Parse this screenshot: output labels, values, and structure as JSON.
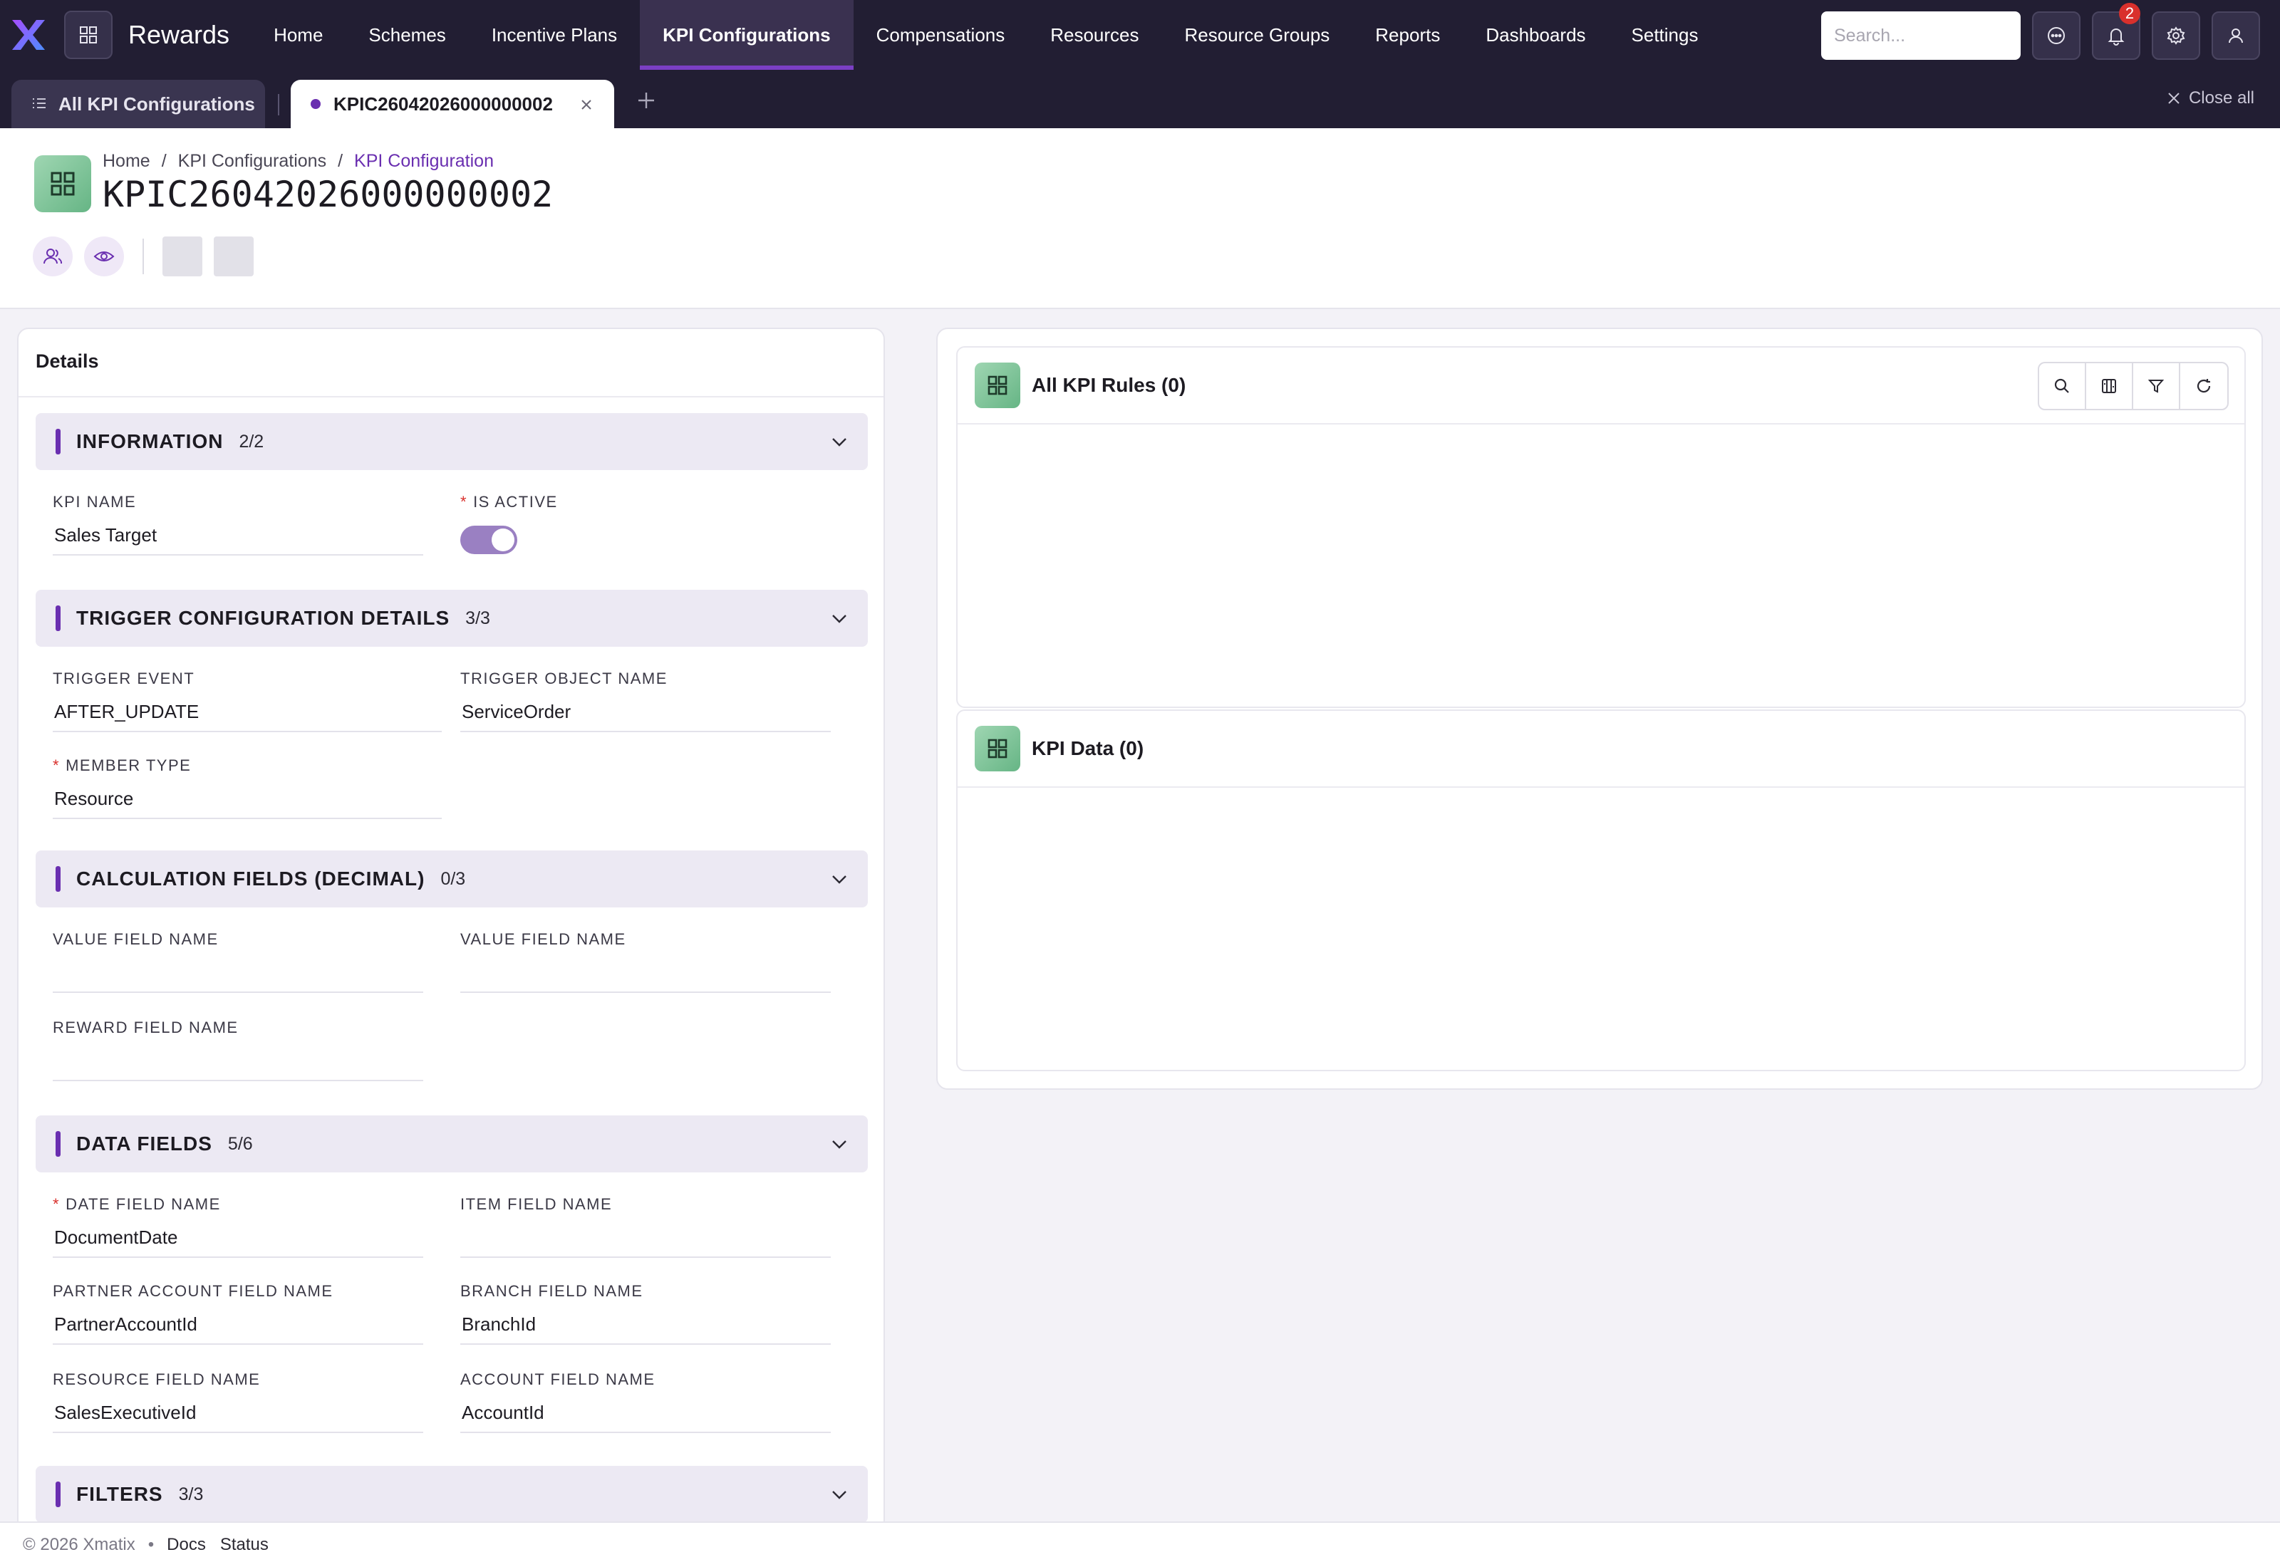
{
  "app": {
    "title": "Rewards"
  },
  "nav": {
    "items": [
      "Home",
      "Schemes",
      "Incentive Plans",
      "KPI Configurations",
      "Compensations",
      "Resources",
      "Resource Groups",
      "Reports",
      "Dashboards",
      "Settings"
    ],
    "active": "KPI Configurations"
  },
  "search": {
    "placeholder": "Search..."
  },
  "notifications": {
    "count": "2"
  },
  "tabs": {
    "list_label": "All KPI Configurations",
    "current_label": "KPIC26042026000000002",
    "close_all": "Close all"
  },
  "breadcrumb": {
    "home": "Home",
    "section": "KPI Configurations",
    "current": "KPI Configuration",
    "sep": "/"
  },
  "page": {
    "title": "KPIC26042026000000002"
  },
  "details": {
    "title": "Details",
    "sections": {
      "information": {
        "title": "INFORMATION",
        "count": "2/2"
      },
      "trigger": {
        "title": "TRIGGER CONFIGURATION DETAILS",
        "count": "3/3"
      },
      "calc": {
        "title": "CALCULATION FIELDS (DECIMAL)",
        "count": "0/3"
      },
      "datafields": {
        "title": "DATA FIELDS",
        "count": "5/6"
      },
      "filters": {
        "title": "FILTERS",
        "count": "3/3"
      }
    },
    "fields": {
      "kpi_name": {
        "label": "KPI NAME",
        "value": "Sales Target"
      },
      "is_active": {
        "label": "IS ACTIVE",
        "required": "*",
        "value": true
      },
      "trigger_event": {
        "label": "TRIGGER EVENT",
        "value": "AFTER_UPDATE"
      },
      "trigger_object": {
        "label": "TRIGGER OBJECT NAME",
        "value": "ServiceOrder"
      },
      "member_type": {
        "label": "MEMBER TYPE",
        "required": "*",
        "value": "Resource"
      },
      "value_field_1": {
        "label": "VALUE FIELD NAME",
        "value": ""
      },
      "value_field_2": {
        "label": "VALUE FIELD NAME",
        "value": ""
      },
      "reward_field": {
        "label": "REWARD FIELD NAME",
        "value": ""
      },
      "date_field": {
        "label": "DATE FIELD NAME",
        "required": "*",
        "value": "DocumentDate"
      },
      "item_field": {
        "label": "ITEM FIELD NAME",
        "value": ""
      },
      "partner_account": {
        "label": "PARTNER ACCOUNT FIELD NAME",
        "value": "PartnerAccountId"
      },
      "branch_field": {
        "label": "BRANCH FIELD NAME",
        "value": "BranchId"
      },
      "resource_field": {
        "label": "RESOURCE FIELD NAME",
        "value": "SalesExecutiveId"
      },
      "account_field": {
        "label": "ACCOUNT FIELD NAME",
        "value": "AccountId"
      }
    }
  },
  "cards": {
    "rules": {
      "title": "All KPI Rules (0)"
    },
    "data": {
      "title": "KPI Data (0)"
    }
  },
  "footer": {
    "copyright": "© 2026 Xmatix",
    "bullet": "•",
    "docs": "Docs",
    "status": "Status"
  },
  "colors": {
    "accent": "#6a2fb0",
    "nav_bg": "#221e33",
    "badge": "#d9302c",
    "toggle_on": "#9a80c2"
  },
  "icons": [
    "x-logo-icon",
    "apps-grid-icon",
    "search-icon",
    "chat-icon",
    "bell-icon",
    "gear-icon",
    "user-icon",
    "list-icon",
    "close-icon",
    "plus-icon",
    "grid-icon",
    "users-icon",
    "eye-icon",
    "chevron-down-icon",
    "columns-icon",
    "filter-icon",
    "refresh-icon"
  ]
}
